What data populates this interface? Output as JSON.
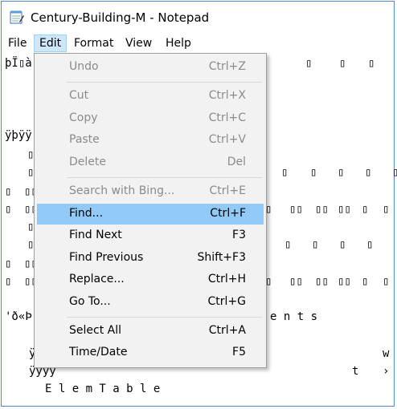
{
  "window": {
    "title": "Century-Building-M - Notepad"
  },
  "menubar": {
    "file": "File",
    "edit": "Edit",
    "format": "Format",
    "view": "View",
    "help": "Help"
  },
  "editor": {
    "line1": "þÏ▯à",
    "line2": "ÿþÿÿ",
    "line3": "'ð«Þ",
    "line4": "ÿ",
    "line5": "ÿÿÿÿ",
    "line6": "E l e m T a b l e",
    "ents": "e n t s",
    "w_char": "w",
    "t_char": "t",
    "arrow_char": "›",
    "box": "▯",
    "dbox": "▯▯"
  },
  "edit_menu": {
    "undo": {
      "label": "Undo",
      "shortcut": "Ctrl+Z"
    },
    "cut": {
      "label": "Cut",
      "shortcut": "Ctrl+X"
    },
    "copy": {
      "label": "Copy",
      "shortcut": "Ctrl+C"
    },
    "paste": {
      "label": "Paste",
      "shortcut": "Ctrl+V"
    },
    "delete": {
      "label": "Delete",
      "shortcut": "Del"
    },
    "search_bing": {
      "label": "Search with Bing...",
      "shortcut": "Ctrl+E"
    },
    "find": {
      "label": "Find...",
      "shortcut": "Ctrl+F"
    },
    "find_next": {
      "label": "Find Next",
      "shortcut": "F3"
    },
    "find_previous": {
      "label": "Find Previous",
      "shortcut": "Shift+F3"
    },
    "replace": {
      "label": "Replace...",
      "shortcut": "Ctrl+H"
    },
    "go_to": {
      "label": "Go To...",
      "shortcut": "Ctrl+G"
    },
    "select_all": {
      "label": "Select All",
      "shortcut": "Ctrl+A"
    },
    "time_date": {
      "label": "Time/Date",
      "shortcut": "F5"
    }
  },
  "colors": {
    "highlight": "#91c9f7",
    "menu_bg": "#f2f2f2",
    "active_menu": "#cce8ff",
    "window_border": "#5b84c4"
  }
}
